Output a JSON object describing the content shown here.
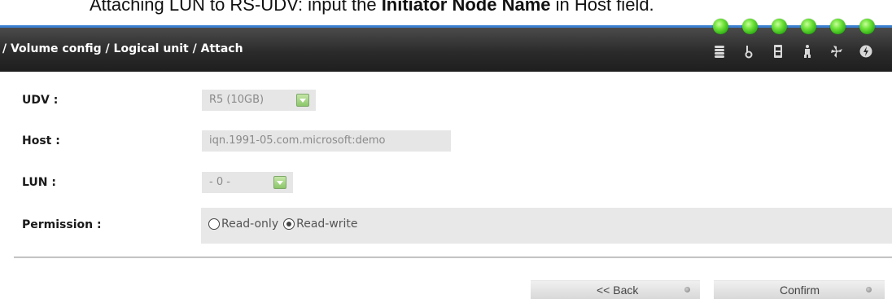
{
  "caption": {
    "prefix": "Attaching LUN to RS-UDV: input the ",
    "bold": "Initiator Node Name",
    "suffix": " in Host field."
  },
  "header": {
    "breadcrumb": "/ Volume config / Logical unit / Attach",
    "status_icons": [
      "disk-icon",
      "temperature-icon",
      "power-supply-icon",
      "ups-icon",
      "fan-icon",
      "voltage-icon"
    ],
    "led_color": "#3cc21f",
    "bar_accent": "#3a7fd0"
  },
  "form": {
    "udv": {
      "label": "UDV :",
      "value": "R5 (10GB)"
    },
    "host": {
      "label": "Host :",
      "value": "iqn.1991-05.com.microsoft:demo"
    },
    "lun": {
      "label": "LUN :",
      "value": "- 0 -"
    },
    "permission": {
      "label": "Permission :",
      "options": [
        {
          "label": "Read-only",
          "selected": false
        },
        {
          "label": "Read-write",
          "selected": true
        }
      ]
    }
  },
  "actions": {
    "back_label": "<< Back",
    "confirm_label": "Confirm"
  }
}
